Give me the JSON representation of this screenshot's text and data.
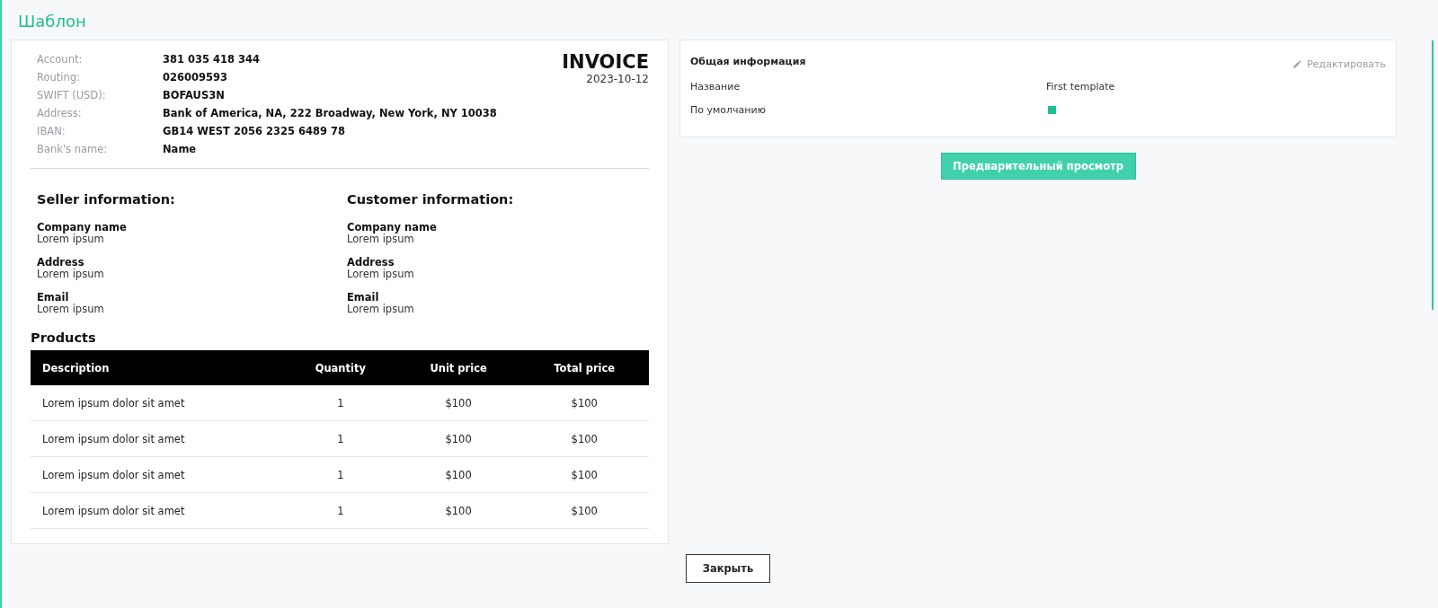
{
  "page_title": "Шаблон",
  "invoice": {
    "bank_details": [
      {
        "label": "Account:",
        "value": "381 035 418 344"
      },
      {
        "label": "Routing:",
        "value": "026009593"
      },
      {
        "label": "SWIFT (USD):",
        "value": "BOFAUS3N"
      },
      {
        "label": "Address:",
        "value": "Bank of America, NA, 222 Broadway, New York, NY 10038"
      },
      {
        "label": "IBAN:",
        "value": "GB14 WEST 2056 2325 6489 78"
      },
      {
        "label": "Bank's name:",
        "value": "Name"
      }
    ],
    "title": "INVOICE",
    "date": "2023-10-12",
    "parties": [
      {
        "heading": "Seller information:",
        "fields": [
          {
            "label": "Company name",
            "value": "Lorem ipsum"
          },
          {
            "label": "Address",
            "value": "Lorem ipsum"
          },
          {
            "label": "Email",
            "value": "Lorem ipsum"
          }
        ]
      },
      {
        "heading": "Customer information:",
        "fields": [
          {
            "label": "Company name",
            "value": "Lorem ipsum"
          },
          {
            "label": "Address",
            "value": "Lorem ipsum"
          },
          {
            "label": "Email",
            "value": "Lorem ipsum"
          }
        ]
      }
    ],
    "products": {
      "heading": "Products",
      "columns": [
        "Description",
        "Quantity",
        "Unit price",
        "Total price"
      ],
      "rows": [
        [
          "Lorem ipsum dolor sit amet",
          "1",
          "$100",
          "$100"
        ],
        [
          "Lorem ipsum dolor sit amet",
          "1",
          "$100",
          "$100"
        ],
        [
          "Lorem ipsum dolor sit amet",
          "1",
          "$100",
          "$100"
        ],
        [
          "Lorem ipsum dolor sit amet",
          "1",
          "$100",
          "$100"
        ]
      ]
    }
  },
  "general_info": {
    "title": "Общая информация",
    "edit_link": "Редактировать",
    "rows": [
      {
        "kind": "text",
        "label": "Название",
        "value": "First template"
      },
      {
        "kind": "checkbox",
        "label": "По умолчанию",
        "checked": true
      }
    ]
  },
  "preview_button": "Предварительный просмотр",
  "close_button": "Закрыть"
}
